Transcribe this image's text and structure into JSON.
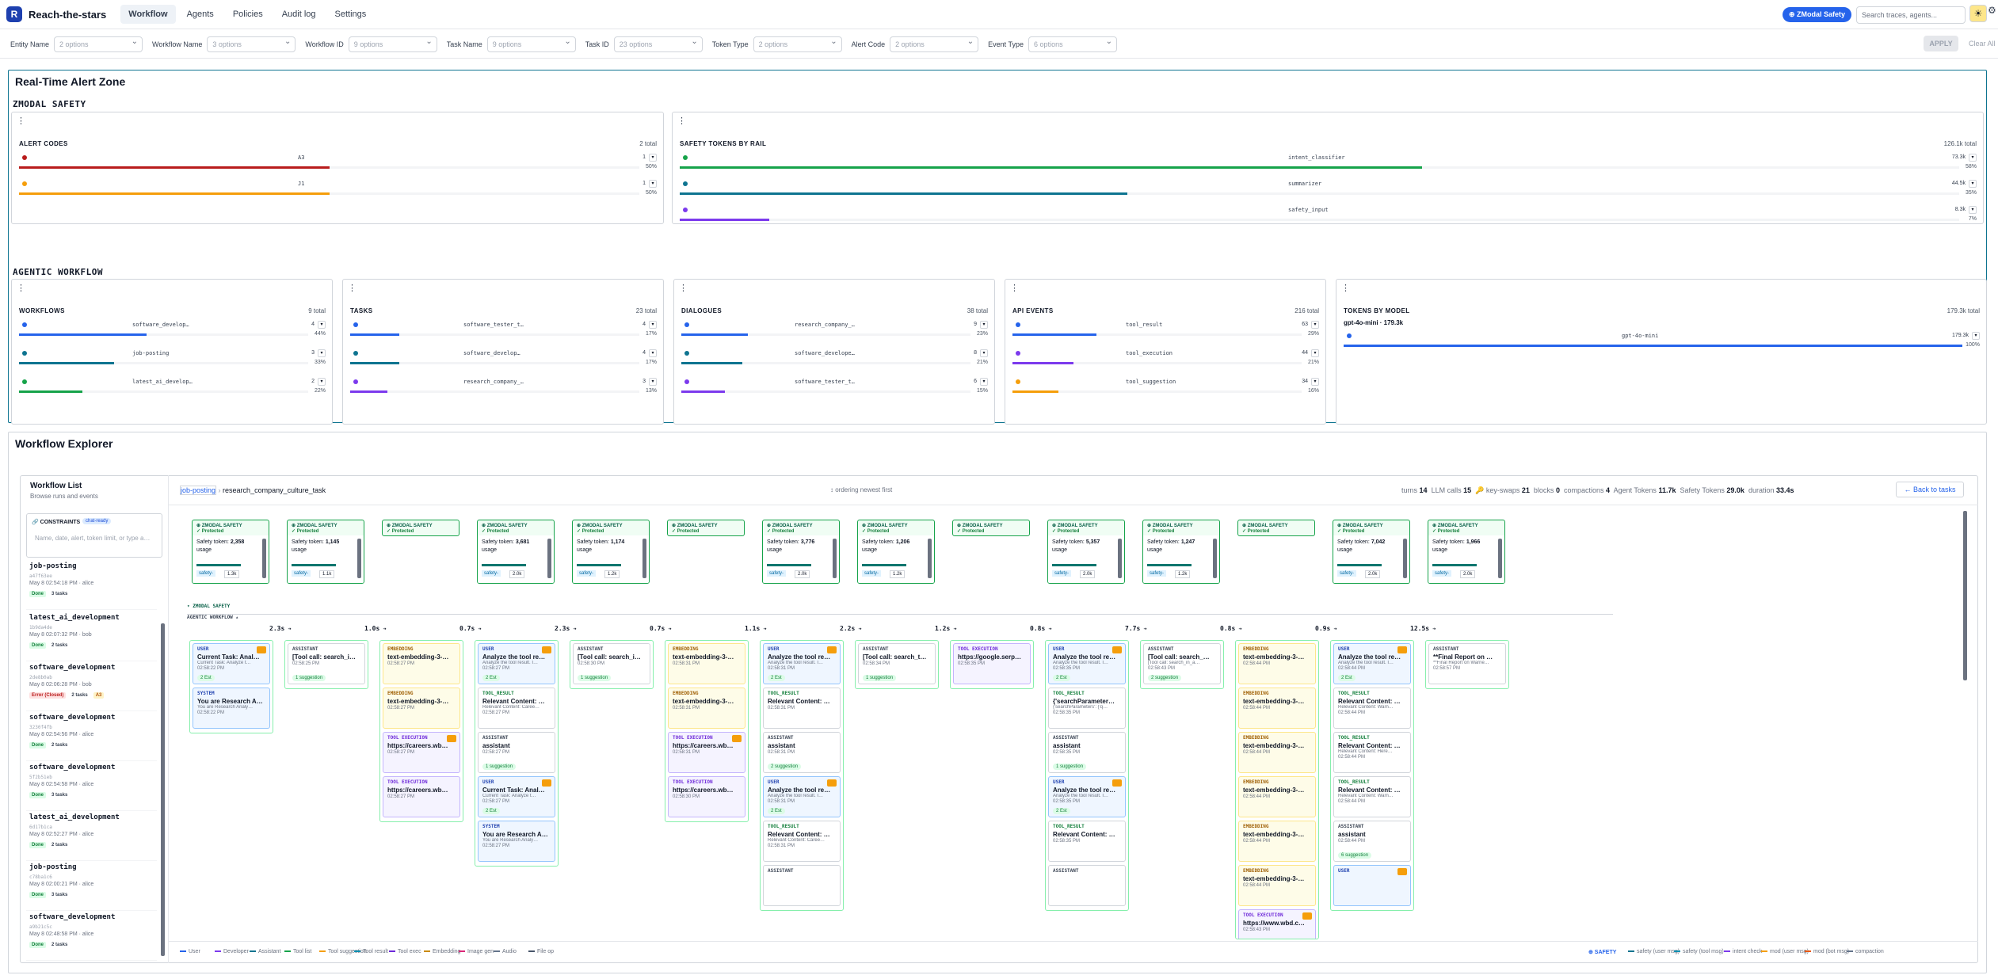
{
  "app": {
    "logo": "R",
    "name": "Reach-the-stars"
  },
  "nav": [
    "Workflow",
    "Agents",
    "Policies",
    "Audit log",
    "Settings"
  ],
  "header": {
    "zbadge": "⊕ ZModal Safety",
    "search_placeholder": "Search traces, agents..."
  },
  "filters": [
    {
      "label": "Entity Name",
      "value": "2 options"
    },
    {
      "label": "Workflow Name",
      "value": "3 options"
    },
    {
      "label": "Workflow ID",
      "value": "9 options"
    },
    {
      "label": "Task Name",
      "value": "9 options"
    },
    {
      "label": "Task ID",
      "value": "23 options"
    },
    {
      "label": "Token Type",
      "value": "2 options"
    },
    {
      "label": "Alert Code",
      "value": "2 options"
    },
    {
      "label": "Event Type",
      "value": "6 options"
    }
  ],
  "filter_actions": {
    "apply": "APPLY",
    "clear": "Clear All"
  },
  "alert_zone": {
    "title": "Real-Time Alert Zone",
    "section_zmodal": "ZMODAL SAFETY",
    "section_agentic": "AGENTIC WORKFLOW"
  },
  "panels": {
    "alert_codes": {
      "title": "ALERT CODES",
      "total": "2 total",
      "rows": [
        {
          "label": "A3",
          "count": "1",
          "pct": "50%",
          "value": 0.5,
          "color": "#b91c1c"
        },
        {
          "label": "J1",
          "count": "1",
          "pct": "50%",
          "value": 0.5,
          "color": "#f59e0b"
        }
      ]
    },
    "safety_tokens": {
      "title": "SAFETY TOKENS BY RAIL",
      "total": "126.1k total",
      "rows": [
        {
          "label": "intent_classifier",
          "count": "73.3k",
          "pct": "58%",
          "value": 0.58,
          "color": "#16a34a"
        },
        {
          "label": "summarizer",
          "count": "44.5k",
          "pct": "35%",
          "value": 0.35,
          "color": "#0e7490"
        },
        {
          "label": "safety_input",
          "count": "8.3k",
          "pct": "7%",
          "value": 0.07,
          "color": "#7c3aed"
        }
      ]
    },
    "workflows": {
      "title": "WORKFLOWS",
      "total": "9 total",
      "rows": [
        {
          "label": "software_develop…",
          "count": "4",
          "pct": "44%",
          "value": 0.44,
          "color": "#2563eb"
        },
        {
          "label": "job-posting",
          "count": "3",
          "pct": "33%",
          "value": 0.33,
          "color": "#0e7490"
        },
        {
          "label": "latest_ai_develop…",
          "count": "2",
          "pct": "22%",
          "value": 0.22,
          "color": "#16a34a"
        }
      ]
    },
    "tasks": {
      "title": "TASKS",
      "total": "23 total",
      "rows": [
        {
          "label": "software_tester_t…",
          "count": "4",
          "pct": "17%",
          "value": 0.17,
          "color": "#2563eb"
        },
        {
          "label": "software_develop…",
          "count": "4",
          "pct": "17%",
          "value": 0.17,
          "color": "#0e7490"
        },
        {
          "label": "research_company_…",
          "count": "3",
          "pct": "13%",
          "value": 0.13,
          "color": "#7c3aed"
        }
      ]
    },
    "dialogues": {
      "title": "DIALOGUES",
      "total": "38 total",
      "rows": [
        {
          "label": "research_company_…",
          "count": "9",
          "pct": "23%",
          "value": 0.23,
          "color": "#2563eb"
        },
        {
          "label": "software_develope…",
          "count": "8",
          "pct": "21%",
          "value": 0.21,
          "color": "#0e7490"
        },
        {
          "label": "software_tester_t…",
          "count": "6",
          "pct": "15%",
          "value": 0.15,
          "color": "#7c3aed"
        }
      ]
    },
    "api_events": {
      "title": "API EVENTS",
      "total": "216 total",
      "rows": [
        {
          "label": "tool_result",
          "count": "63",
          "pct": "29%",
          "value": 0.29,
          "color": "#2563eb"
        },
        {
          "label": "tool_execution",
          "count": "44",
          "pct": "21%",
          "value": 0.21,
          "color": "#7c3aed"
        },
        {
          "label": "tool_suggestion",
          "count": "34",
          "pct": "16%",
          "value": 0.16,
          "color": "#f59e0b"
        }
      ]
    },
    "tokens_by_model": {
      "title": "TOKENS BY MODEL",
      "total": "179.3k total",
      "headline": "gpt-4o-mini · 179.3k",
      "rows": [
        {
          "label": "gpt-4o-mini",
          "count": "179.3k",
          "pct": "100%",
          "value": 1.0,
          "color": "#2563eb"
        }
      ]
    }
  },
  "explorer": {
    "title": "Workflow Explorer",
    "list_title": "Workflow List",
    "list_sub": "Browse runs and events",
    "constraints": "CONSTRAINTS",
    "constraints_chip": "chat-ready",
    "constraints_placeholder": "Name, date, alert, token limit, or type a…",
    "workflows": [
      {
        "name": "job-posting",
        "id": "a47f63ee",
        "date": "May 8 02:54:18 PM · alice",
        "status": "Done",
        "tasks": "3 tasks"
      },
      {
        "name": "latest_ai_development",
        "id": "1b9da4de",
        "date": "May 8 02:07:32 PM · bob",
        "status": "Done",
        "tasks": "2 tasks"
      },
      {
        "name": "software_development",
        "id": "2de8b0ab",
        "date": "May 8 02:06:28 PM · bob",
        "status": "Error (Closed)",
        "tasks": "2 tasks",
        "alert": "A3"
      },
      {
        "name": "software_development",
        "id": "3230f4fb",
        "date": "May 8 02:54:56 PM · alice",
        "status": "Done",
        "tasks": "2 tasks"
      },
      {
        "name": "software_development",
        "id": "5f2b51eb",
        "date": "May 8 02:54:58 PM · alice",
        "status": "Done",
        "tasks": "3 tasks"
      },
      {
        "name": "latest_ai_development",
        "id": "6d17b1ca",
        "date": "May 8 02:52:27 PM · alice",
        "status": "Done",
        "tasks": "2 tasks"
      },
      {
        "name": "job-posting",
        "id": "c78ba1c6",
        "date": "May 8 02:00:21 PM · alice",
        "status": "Done",
        "tasks": "3 tasks"
      },
      {
        "name": "software_development",
        "id": "a9b21c5c",
        "date": "May 8 02:48:58 PM · alice",
        "status": "Done",
        "tasks": "2 tasks"
      }
    ],
    "crumb": {
      "parent": "job-posting",
      "child": "research_company_culture_task"
    },
    "ordering": "↕ ordering  newest first",
    "stats": {
      "turns": "14",
      "llm": "15",
      "keys": "21",
      "blocks": "0",
      "compactions": "4",
      "agent_tokens": "11.7k",
      "safety_tokens": "29.0k",
      "duration": "33.4s"
    },
    "stat_labels": {
      "turns": "turns",
      "llm": "LLM calls",
      "keys": "key-swaps",
      "blocks": "blocks",
      "compactions": "compactions",
      "agent": "Agent Tokens",
      "safety": "Safety Tokens",
      "duration": "duration"
    },
    "back": "← Back to tasks",
    "lane_z": "▾ ZMODAL SAFETY",
    "lane_a": "AGENTIC WORKFLOW ▴",
    "zmodal_cards": [
      {
        "tokens": "2,358",
        "usage": "1.3k",
        "full": true
      },
      {
        "tokens": "1,145",
        "usage": "1.1k",
        "full": true
      },
      {
        "full": false
      },
      {
        "tokens": "3,681",
        "usage": "2.0k",
        "full": true
      },
      {
        "tokens": "1,174",
        "usage": "1.2k",
        "full": true
      },
      {
        "full": false
      },
      {
        "tokens": "3,776",
        "usage": "2.0k",
        "full": true
      },
      {
        "tokens": "1,206",
        "usage": "1.2k",
        "full": true
      },
      {
        "full": false
      },
      {
        "tokens": "5,357",
        "usage": "2.0k",
        "full": true
      },
      {
        "tokens": "1,247",
        "usage": "1.2k",
        "full": true
      },
      {
        "full": false
      },
      {
        "tokens": "7,042",
        "usage": "2.0k",
        "full": true
      },
      {
        "tokens": "1,966",
        "usage": "2.0k",
        "full": true
      }
    ],
    "zm_title": "⊕ ZMODAL SAFETY",
    "zm_protected": "✓ Protected",
    "zm_token_label": "Safety token:",
    "zm_usage": "usage",
    "zm_chip": "safety-",
    "times": [
      "2.3s",
      "1.0s",
      "0.7s",
      "2.3s",
      "0.7s",
      "1.1s",
      "2.2s",
      "1.2s",
      "0.8s",
      "7.7s",
      "0.8s",
      "0.9s",
      "12.5s"
    ],
    "columns": [
      [
        {
          "k": "u",
          "role": "USER",
          "title": "Current Task: Anal…",
          "sub": "Current Task: Analyze t…",
          "time": "02:58:22 PM",
          "pill": "2 Est",
          "c": 1
        },
        {
          "k": "s",
          "role": "SYSTEM",
          "title": "You are Research A…",
          "sub": "You are Research Analy…",
          "time": "02:58:22 PM"
        }
      ],
      [
        {
          "k": "a",
          "role": "ASSISTANT",
          "title": "[Tool call: search_i…",
          "time": "02:58:25 PM",
          "pill": "1 suggestion"
        }
      ],
      [
        {
          "k": "e",
          "role": "EMBEDDING",
          "title": "text-embedding-3-…",
          "time": "02:58:27 PM"
        },
        {
          "k": "e",
          "role": "EMBEDDING",
          "title": "text-embedding-3-…",
          "time": "02:58:27 PM"
        },
        {
          "k": "x",
          "role": "TOOL EXECUTION",
          "title": "https://careers.wb…",
          "time": "02:58:27 PM",
          "c": 1
        },
        {
          "k": "x",
          "role": "TOOL EXECUTION",
          "title": "https://careers.wb…",
          "time": "02:58:27 PM"
        }
      ],
      [
        {
          "k": "u",
          "role": "USER",
          "title": "Analyze the tool re…",
          "sub": "Analyze the tool result. I…",
          "time": "02:58:27 PM",
          "pill": "2 Est",
          "c": 1
        },
        {
          "k": "r",
          "role": "TOOL_RESULT",
          "title": "Relevant Content: …",
          "sub": "Relevant Content: Caree…",
          "time": "02:58:27 PM"
        },
        {
          "k": "a",
          "role": "ASSISTANT",
          "title": "assistant",
          "time": "02:58:27 PM",
          "pill": "1 suggestion"
        },
        {
          "k": "u",
          "role": "USER",
          "title": "Current Task: Anal…",
          "sub": "Current Task: Analyze t…",
          "time": "02:58:27 PM",
          "pill": "2 Est",
          "c": 1
        },
        {
          "k": "s",
          "role": "SYSTEM",
          "title": "You are Research A…",
          "sub": "You are Research Analy…",
          "time": "02:58:27 PM"
        }
      ],
      [
        {
          "k": "a",
          "role": "ASSISTANT",
          "title": "[Tool call: search_i…",
          "time": "02:58:30 PM",
          "pill": "1 suggestion"
        }
      ],
      [
        {
          "k": "e",
          "role": "EMBEDDING",
          "title": "text-embedding-3-…",
          "time": "02:58:31 PM"
        },
        {
          "k": "e",
          "role": "EMBEDDING",
          "title": "text-embedding-3-…",
          "time": "02:58:31 PM"
        },
        {
          "k": "x",
          "role": "TOOL EXECUTION",
          "title": "https://careers.wb…",
          "time": "02:58:31 PM",
          "c": 1
        },
        {
          "k": "x",
          "role": "TOOL EXECUTION",
          "title": "https://careers.wb…",
          "time": "02:58:30 PM"
        }
      ],
      [
        {
          "k": "u",
          "role": "USER",
          "title": "Analyze the tool re…",
          "sub": "Analyze the tool result. I…",
          "time": "02:58:31 PM",
          "pill": "2 Est",
          "c": 1
        },
        {
          "k": "r",
          "role": "TOOL_RESULT",
          "title": "Relevant Content: …",
          "time": "02:58:31 PM"
        },
        {
          "k": "a",
          "role": "ASSISTANT",
          "title": "assistant",
          "time": "02:58:31 PM",
          "pill": "2 suggestion"
        },
        {
          "k": "u",
          "role": "USER",
          "title": "Analyze the tool re…",
          "sub": "Analyze the tool result. I…",
          "time": "02:58:31 PM",
          "pill": "2 Est",
          "c": 1
        },
        {
          "k": "r",
          "role": "TOOL_RESULT",
          "title": "Relevant Content: …",
          "sub": "Relevant Content: Caree…",
          "time": "02:58:31 PM"
        },
        {
          "k": "a",
          "role": "ASSISTANT",
          "title": "",
          "time": ""
        }
      ],
      [
        {
          "k": "a",
          "role": "ASSISTANT",
          "title": "[Tool call: search_t…",
          "time": "02:58:34 PM",
          "pill": "1 suggestion"
        }
      ],
      [
        {
          "k": "x",
          "role": "TOOL EXECUTION",
          "title": "https://google.serp…",
          "time": "02:58:35 PM"
        }
      ],
      [
        {
          "k": "u",
          "role": "USER",
          "title": "Analyze the tool re…",
          "sub": "Analyze the tool result. I…",
          "time": "02:58:35 PM",
          "pill": "2 Est",
          "c": 1
        },
        {
          "k": "r",
          "role": "TOOL_RESULT",
          "title": "{'searchParameter…",
          "sub": "{'searchParameters': {'q…",
          "time": "02:58:35 PM"
        },
        {
          "k": "a",
          "role": "ASSISTANT",
          "title": "assistant",
          "time": "02:58:35 PM",
          "pill": "1 suggestion"
        },
        {
          "k": "u",
          "role": "USER",
          "title": "Analyze the tool re…",
          "sub": "Analyze the tool result. I…",
          "time": "02:58:35 PM",
          "pill": "2 Est",
          "c": 1
        },
        {
          "k": "r",
          "role": "TOOL_RESULT",
          "title": "Relevant Content: …",
          "time": "02:58:35 PM"
        },
        {
          "k": "a",
          "role": "ASSISTANT",
          "title": "",
          "time": ""
        }
      ],
      [
        {
          "k": "a",
          "role": "ASSISTANT",
          "title": "[Tool call: search_…",
          "sub": "[Tool call: search_in_a…",
          "time": "02:58:43 PM",
          "pill": "2 suggestion"
        }
      ],
      [
        {
          "k": "e",
          "role": "EMBEDDING",
          "title": "text-embedding-3-…",
          "time": "02:58:44 PM"
        },
        {
          "k": "e",
          "role": "EMBEDDING",
          "title": "text-embedding-3-…",
          "time": "02:58:44 PM"
        },
        {
          "k": "e",
          "role": "EMBEDDING",
          "title": "text-embedding-3-…",
          "time": "02:58:44 PM"
        },
        {
          "k": "e",
          "role": "EMBEDDING",
          "title": "text-embedding-3-…",
          "time": "02:58:44 PM"
        },
        {
          "k": "e",
          "role": "EMBEDDING",
          "title": "text-embedding-3-…",
          "time": "02:58:44 PM"
        },
        {
          "k": "e",
          "role": "EMBEDDING",
          "title": "text-embedding-3-…",
          "time": "02:58:44 PM"
        },
        {
          "k": "x",
          "role": "TOOL EXECUTION",
          "title": "https://www.wbd.c…",
          "time": "02:58:43 PM",
          "c": 1
        }
      ],
      [
        {
          "k": "u",
          "role": "USER",
          "title": "Analyze the tool re…",
          "sub": "Analyze the tool result. I…",
          "time": "02:58:44 PM",
          "pill": "2 Est",
          "c": 1
        },
        {
          "k": "r",
          "role": "TOOL_RESULT",
          "title": "Relevant Content: …",
          "sub": "Relevant Content: Warn…",
          "time": "02:58:44 PM"
        },
        {
          "k": "r",
          "role": "TOOL_RESULT",
          "title": "Relevant Content: …",
          "sub": "Relevant Content: Here…",
          "time": "02:58:44 PM"
        },
        {
          "k": "r",
          "role": "TOOL_RESULT",
          "title": "Relevant Content: …",
          "sub": "Relevant Content: Warn…",
          "time": "02:58:44 PM"
        },
        {
          "k": "a",
          "role": "ASSISTANT",
          "title": "assistant",
          "time": "02:58:44 PM",
          "pill": "6 suggestion"
        },
        {
          "k": "u",
          "role": "USER",
          "title": "",
          "time": "",
          "c": 1
        }
      ],
      [
        {
          "k": "a",
          "role": "ASSISTANT",
          "title": "**Final Report on …",
          "sub": "**Final Report on Warne…",
          "time": "02:58:57 PM"
        }
      ]
    ],
    "legend_left": [
      "User",
      "Developer",
      "Assistant",
      "Tool list",
      "Tool suggestion",
      "Tool result",
      "Tool exec",
      "Embedding",
      "Image gen",
      "Audio",
      "File op"
    ],
    "legend_right_title": "⊕ SAFETY",
    "legend_right": [
      "safety (user msg)",
      "safety (tool msg)",
      "intent check",
      "mod (user msg)",
      "mod (bot msg)",
      "compaction"
    ]
  }
}
